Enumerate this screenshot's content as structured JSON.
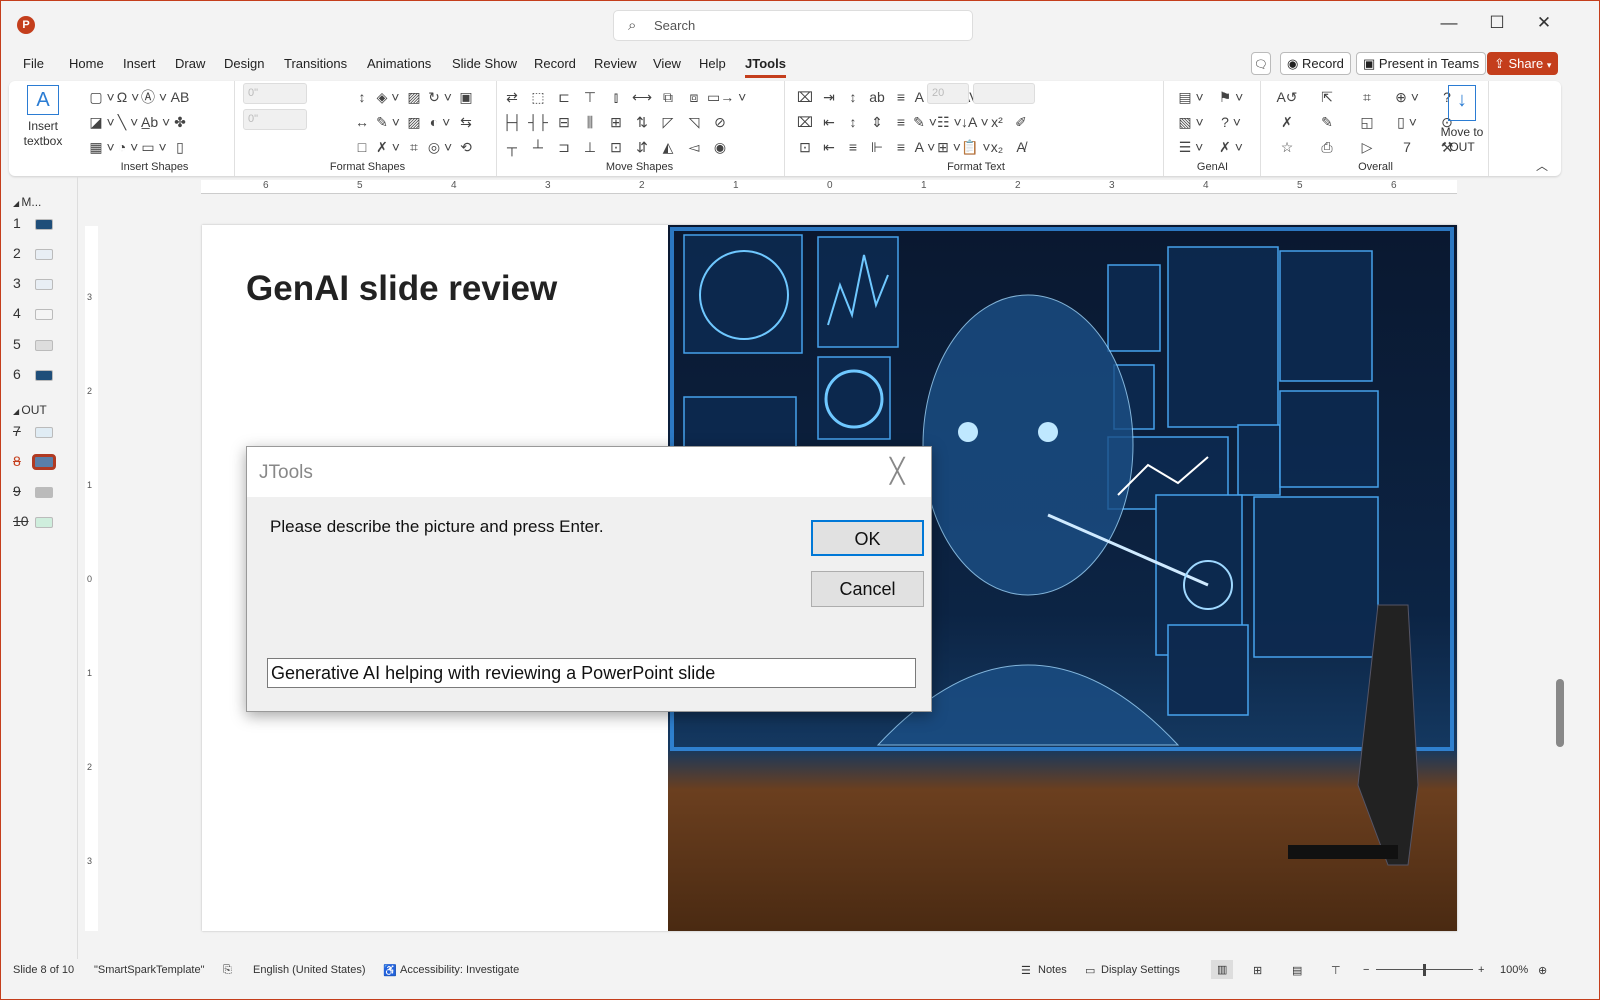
{
  "app": {
    "icon_letter": "P",
    "search_placeholder": "Search"
  },
  "window": {
    "minimize": "—",
    "maximize": "☐",
    "close": "✕"
  },
  "tabs": [
    "File",
    "Home",
    "Insert",
    "Draw",
    "Design",
    "Transitions",
    "Animations",
    "Slide Show",
    "Record",
    "Review",
    "View",
    "Help",
    "JTools"
  ],
  "active_tab": "JTools",
  "top_buttons": {
    "comments_icon": "🗨",
    "record": "Record",
    "present": "Present in Teams",
    "share": "Share"
  },
  "ribbon": {
    "insert_textbox": "Insert textbox",
    "move_to_out": "Move to OUT",
    "spin1": "0\"",
    "spin2": "0\"",
    "font_size": "20",
    "groups": [
      {
        "label": "Insert Shapes",
        "icons": [
          [
            "rectangle-icon",
            "▢ ˅"
          ],
          [
            "shape-fill-icon",
            "◪ ˅"
          ],
          [
            "table-icon",
            "▦ ˅"
          ],
          [
            "omega-symbol-icon",
            "Ω ˅"
          ],
          [
            "line-icon",
            "╲ ˅"
          ],
          [
            "pie-icon",
            "◔ ˅"
          ],
          [
            "text-circle-icon",
            "Ⓐ ˅"
          ],
          [
            "text-underline-icon",
            "A̲b ˅"
          ],
          [
            "sticky-note-icon",
            "▭ ˅"
          ],
          [
            "caps-icon",
            "AB"
          ],
          [
            "bird-icon",
            "✤"
          ],
          [
            "document-icon",
            "▯"
          ]
        ]
      },
      {
        "label": "Format Shapes",
        "icons": [
          [
            "height-icon",
            "↕"
          ],
          [
            "width-icon",
            "↔"
          ],
          [
            "square-icon",
            "□"
          ],
          [
            "fill-color-icon",
            "◈ ˅"
          ],
          [
            "outline-color-icon",
            "✎ ˅"
          ],
          [
            "remove-icon",
            "✗ ˅"
          ],
          [
            "picture-icon",
            "▨"
          ],
          [
            "picture2-icon",
            "▨"
          ],
          [
            "crop-icon",
            "⌗"
          ],
          [
            "rotate-icon",
            "↻ ˅"
          ],
          [
            "shape-effects-icon",
            "◐ ˅"
          ],
          [
            "merge-icon",
            "◎ ˅"
          ],
          [
            "image-frame-icon",
            "▣"
          ],
          [
            "swap-icon",
            "⇆"
          ],
          [
            "sync-icon",
            "⟲"
          ]
        ]
      },
      {
        "label": "Move Shapes",
        "icons": [
          [
            "swap-shapes-icon",
            "⇄"
          ],
          [
            "same-width-icon",
            "├┤"
          ],
          [
            "same-height-icon",
            "┬"
          ],
          [
            "select-icon",
            "⬚"
          ],
          [
            "resize-icon",
            "┤├"
          ],
          [
            "vertical-icon",
            "┴"
          ],
          [
            "align-left-icon",
            "⊏"
          ],
          [
            "align-center-icon",
            "⊟"
          ],
          [
            "align-bottom-icon",
            "⊐"
          ],
          [
            "align-top-icon",
            "⊤"
          ],
          [
            "distribute-icon",
            "⫼"
          ],
          [
            "distribute-v-icon",
            "⊥"
          ],
          [
            "align-middle-icon",
            "⫾"
          ],
          [
            "center-icon",
            "⊞"
          ],
          [
            "stack-icon",
            "⊡"
          ],
          [
            "spread-h-icon",
            "⟷"
          ],
          [
            "spread-v-icon",
            "⇅"
          ],
          [
            "spread-icon",
            "⇵"
          ],
          [
            "copy-icon",
            "⧉"
          ],
          [
            "rotate-left-icon",
            "◸"
          ],
          [
            "flip-h-icon",
            "◭"
          ],
          [
            "group-icon",
            "⧈"
          ],
          [
            "rotate-right-icon",
            "◹"
          ],
          [
            "flip-v-icon",
            "◅"
          ],
          [
            "move-right-icon",
            "▭→ ˅"
          ],
          [
            "hide-icon",
            "⊘"
          ],
          [
            "show-icon",
            "◉"
          ]
        ]
      },
      {
        "label": "Format Text",
        "icons": [
          [
            "text-in-icon",
            "⌧"
          ],
          [
            "text-out-icon",
            "⌧"
          ],
          [
            "textbox-icon",
            "⊡"
          ],
          [
            "indent-icon",
            "⇥"
          ],
          [
            "outdent-icon",
            "⇤"
          ],
          [
            "indent-left-icon",
            "⇤"
          ],
          [
            "spacing-up-icon",
            "↕"
          ],
          [
            "spacing-down-icon",
            "↕"
          ],
          [
            "align-text-icon",
            "≡"
          ],
          [
            "autofit-icon",
            "ab"
          ],
          [
            "wrap-icon",
            "⇕"
          ],
          [
            "ruler-icon",
            "⊩"
          ],
          [
            "justify-icon",
            "≡"
          ],
          [
            "justify2-icon",
            "≡"
          ],
          [
            "justify3-icon",
            "≡"
          ],
          [
            "font-name-icon",
            "A ˅"
          ],
          [
            "highlight-icon",
            "✎ ˅"
          ],
          [
            "font-size-icon",
            "A ˅"
          ],
          [
            "line-spacing-icon",
            "☰ ˅"
          ],
          [
            "bullets-icon",
            "☷ ˅"
          ],
          [
            "numbering-icon",
            "⊞ ˅"
          ],
          [
            "char-spacing-icon",
            "AV ˅"
          ],
          [
            "sort-icon",
            "↓A ˅"
          ],
          [
            "paste-format-icon",
            "📋 ˅"
          ],
          [
            "columns-icon",
            "☷"
          ],
          [
            "superscript-icon",
            "x²"
          ],
          [
            "subscript-icon",
            "x₂"
          ],
          [
            "strikethrough-icon",
            "ab̶"
          ],
          [
            "brush-icon",
            "✐"
          ],
          [
            "clear-format-icon",
            "A̸"
          ]
        ]
      },
      {
        "label": "GenAI",
        "icons": [
          [
            "summary-icon",
            "▤ ˅"
          ],
          [
            "image-gen-icon",
            "▧ ˅"
          ],
          [
            "list-icon",
            "☰ ˅"
          ],
          [
            "flag-icon",
            "⚑ ˅"
          ],
          [
            "question-icon",
            "? ˅"
          ],
          [
            "delete-slides-icon",
            "✗ ˅"
          ]
        ]
      },
      {
        "label": "Overall",
        "icons": [
          [
            "translate-icon",
            "A↺"
          ],
          [
            "delete-icon",
            "✗"
          ],
          [
            "favorite-icon",
            "☆"
          ],
          [
            "export-icon",
            "⇱"
          ],
          [
            "save-icon",
            "✎"
          ],
          [
            "print-icon",
            "⎙"
          ],
          [
            "crop-slide-icon",
            "⌗"
          ],
          [
            "resize-slide-icon",
            "◱"
          ],
          [
            "select-slide-icon",
            "▷"
          ],
          [
            "web-icon",
            "⊕ ˅"
          ],
          [
            "pdf-icon",
            "▯ ˅"
          ],
          [
            "calendar-icon",
            "7"
          ],
          [
            "help-icon",
            "?"
          ],
          [
            "timer-icon",
            "⊙"
          ],
          [
            "tools-icon",
            "⚒"
          ]
        ]
      }
    ],
    "collapse": "︿"
  },
  "ruler_h": [
    "6",
    "5",
    "4",
    "3",
    "2",
    "1",
    "0",
    "1",
    "2",
    "3",
    "4",
    "5",
    "6"
  ],
  "ruler_v": [
    "3",
    "2",
    "1",
    "0",
    "1",
    "2",
    "3"
  ],
  "thumbnails": {
    "sections": [
      "M...",
      "OUT"
    ],
    "slides": [
      {
        "n": "1"
      },
      {
        "n": "2"
      },
      {
        "n": "3"
      },
      {
        "n": "4"
      },
      {
        "n": "5"
      },
      {
        "n": "6"
      },
      {
        "n": "7"
      },
      {
        "n": "8"
      },
      {
        "n": "9"
      },
      {
        "n": "10"
      }
    ],
    "selected": "8"
  },
  "slide": {
    "title": "GenAI slide review"
  },
  "dialog": {
    "title": "JTools",
    "prompt": "Please describe the picture and press Enter.",
    "ok": "OK",
    "cancel": "Cancel",
    "input_value": "Generative AI helping with reviewing a PowerPoint slide"
  },
  "status": {
    "slide": "Slide 8 of 10",
    "template": "\"SmartSparkTemplate\"",
    "language": "English (United States)",
    "accessibility": "Accessibility: Investigate",
    "notes": "Notes",
    "display": "Display Settings",
    "zoom": "100%",
    "zoom_level_percent": 100
  },
  "colors": {
    "accent": "#c43e1c",
    "dialog_focus": "#0078d7"
  }
}
